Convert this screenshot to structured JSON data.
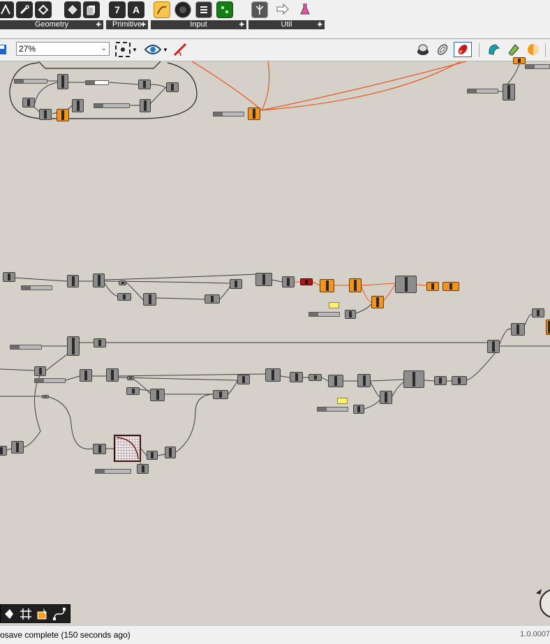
{
  "ribbon": {
    "groups": [
      {
        "label": "Geometry",
        "icons": [
          "curve-icon",
          "wrench-icon",
          "diamond-icon"
        ]
      },
      {
        "label": "",
        "icons": [
          "surface-icon",
          "pages-icon"
        ]
      },
      {
        "label": "Primitive",
        "icons": [
          "integer-icon",
          "text-icon"
        ]
      },
      {
        "label": "Input",
        "icons": [
          "graph-mapper-icon",
          "toggle-icon",
          "value-list-icon",
          "gradient-icon"
        ]
      },
      {
        "label": "Util",
        "icons": [
          "tree-icon",
          "arrow-icon",
          "flask-icon"
        ]
      }
    ],
    "primitive_glyphs": [
      "7",
      "A"
    ]
  },
  "toolbar": {
    "zoom_value": "27%",
    "right_icons": [
      "preview-mode-icon",
      "wireframe-icon",
      "shaded-selected-icon",
      "cyan-mesh-icon",
      "green-mesh-icon",
      "sphere-icon"
    ]
  },
  "status": {
    "message": "osave complete (150 seconds ago)",
    "version": "1.0.0007"
  },
  "colors": {
    "canvas": "#d5d1c9",
    "component": "#8d8d8d",
    "component_orange": "#f3941c",
    "component_error": "#b01616",
    "wire": "#3c3c3c",
    "wire_selected": "#e8531c",
    "panel": "#fbf072"
  }
}
